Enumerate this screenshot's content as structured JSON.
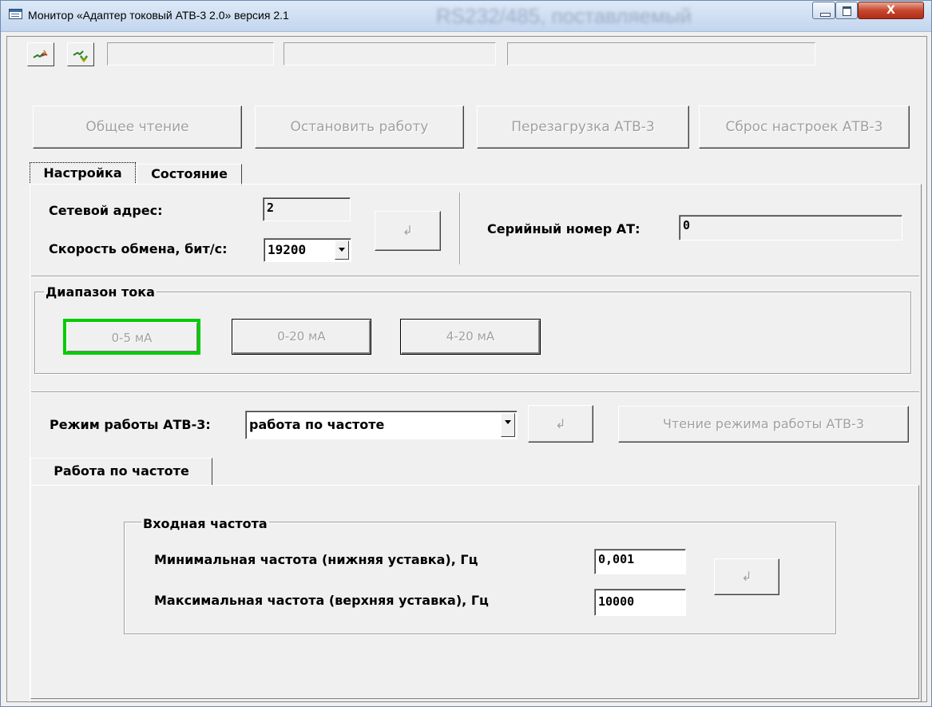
{
  "window": {
    "title": "Монитор «Адаптер токовый АТВ-3 2.0» версия 2.1",
    "blurred_title_tail": "RS232/485, поставляемый",
    "close_label": "X"
  },
  "toolbar": {
    "connect_icon": "connect-icon",
    "settings_icon": "port-settings-icon",
    "status_fields": [
      "",
      "",
      ""
    ]
  },
  "actions": {
    "read_all": "Общее чтение",
    "stop": "Остановить работу",
    "reboot": "Перезагрузка АТВ-3",
    "reset": "Сброс настроек АТВ-3"
  },
  "tabs": {
    "settings": "Настройка",
    "state": "Состояние"
  },
  "network": {
    "address_label": "Сетевой адрес:",
    "address_value": "2",
    "speed_label": "Скорость обмена, бит/с:",
    "speed_value": "19200",
    "apply_symbol": "↲",
    "serial_label": "Серийный номер АТ:",
    "serial_value": "0"
  },
  "current_range": {
    "title": "Диапазон тока",
    "options": [
      "0-5 мА",
      "0-20 мА",
      "4-20 мА"
    ],
    "selected_color": "#00cc00"
  },
  "mode": {
    "label": "Режим работы АТВ-3:",
    "value": "работа по частоте",
    "apply_symbol": "↲",
    "read_label": "Чтение режима работы АТВ-3"
  },
  "subtab": {
    "label": "Работа по частоте"
  },
  "frequency": {
    "title": "Входная частота",
    "min_label": "Минимальная частота (нижняя уставка), Гц",
    "min_value": "0,001",
    "max_label": "Максимальная частота (верхняя уставка), Гц",
    "max_value": "10000",
    "apply_symbol": "↲"
  }
}
